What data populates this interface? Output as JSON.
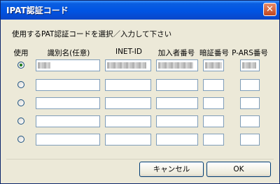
{
  "window": {
    "title": "IPAT認証コード",
    "close_symbol": "✕"
  },
  "instruction": "使用するPAT認証コードを選択／入力して下さい",
  "headers": {
    "use": "使用",
    "name": "識別名(任意)",
    "inet_id": "INET-ID",
    "subscriber": "加入者番号",
    "pin": "暗証番号",
    "pars": "P-ARS番号"
  },
  "rows": [
    {
      "selected": true
    },
    {
      "selected": false
    },
    {
      "selected": false
    },
    {
      "selected": false
    },
    {
      "selected": false
    }
  ],
  "buttons": {
    "cancel": "キャンセル",
    "ok": "OK"
  }
}
